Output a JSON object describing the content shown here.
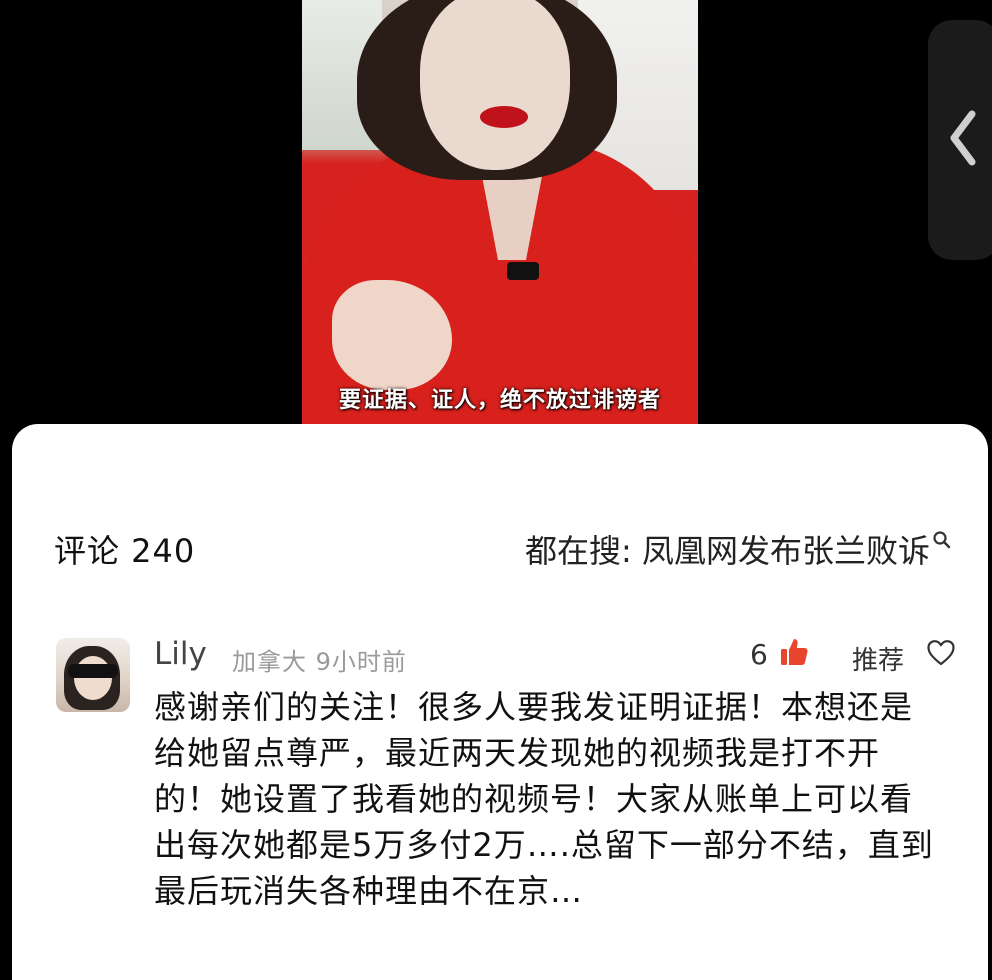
{
  "video": {
    "subtitle": "要证据、证人，绝不放过诽谤者"
  },
  "side_panel": {
    "icon": "chevron-left-icon"
  },
  "comments": {
    "header": "评论 240",
    "trending": "都在搜: 凤凰网发布张兰败诉",
    "trending_icon": "search-icon"
  },
  "comment": {
    "username": "Lily",
    "meta": "加拿大 9小时前",
    "likes": "6",
    "like_icon": "thumbs-up-icon",
    "recommend": "推荐",
    "recommend_icon": "heart-icon",
    "text": "感谢亲们的关注！很多人要我发证明证据！本想还是给她留点尊严，最近两天发现她的视频我是打不开的！她设置了我看她的视频号！大家从账单上可以看出每次她都是5万多付2万….总留下一部分不结，直到最后玩消失各种理由不在京…"
  },
  "colors": {
    "like_accent": "#e8452f",
    "sheet_bg": "#ffffff",
    "page_bg": "#000000"
  }
}
